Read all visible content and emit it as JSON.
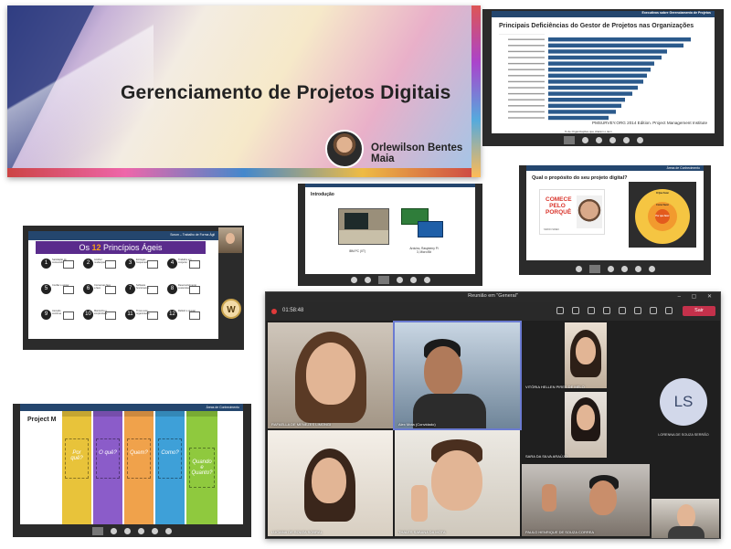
{
  "title_card": {
    "title": "Gerenciamento de Projetos Digitais",
    "presenter": "Orlewilson Bentes Maia"
  },
  "deficiencies_slide": {
    "header": "Executivos sobre Gerenciamento de Projetos",
    "title": "Principais Deficiências do Gestor de Projetos nas Organizações",
    "source": "PMSURVEY.ORG 2014 Edition. Project Management Institute",
    "xlabel": "% de Organizações que citaram o item"
  },
  "intro_slide": {
    "label": "Introdução",
    "header": "Contextualização",
    "pc_caption": "IBM PC (XT)",
    "board_caption": "Arduino, Raspberry Pi 3, Micro:Bit"
  },
  "purpose_slide": {
    "header": "Áreas de Conhecimento",
    "question": "Qual o propósito do seu projeto digital?",
    "book_title": "COMECE PELO PORQUÊ",
    "book_author": "SIMON SINEK",
    "gc_what": "O Que Fazer",
    "gc_how": "Como Fazer",
    "gc_why": "Por que fazer"
  },
  "agile_slide": {
    "header": "Scrum – Trabalho de Forma Ágil",
    "banner_prefix": "Os",
    "banner_number": "12",
    "banner_suffix": "Princípios Ágeis",
    "avatar_initial": "W",
    "principles": [
      {
        "n": "1",
        "t": "Satisfação do consumidor"
      },
      {
        "n": "2",
        "t": "Acolher mudanças"
      },
      {
        "n": "3",
        "t": "Entregas frequentes"
      },
      {
        "n": "4",
        "t": "Trabalho em conjunto"
      },
      {
        "n": "5",
        "t": "Confiar e apoiar"
      },
      {
        "n": "6",
        "t": "Conversas face a face"
      },
      {
        "n": "7",
        "t": "Software funcionando"
      },
      {
        "n": "8",
        "t": "Desenvolvimento sustentável"
      },
      {
        "n": "9",
        "t": "Atenção contínua"
      },
      {
        "n": "10",
        "t": "Mantenha a simplicidade"
      },
      {
        "n": "11",
        "t": "Times auto-organizáveis"
      },
      {
        "n": "12",
        "t": "Refletir e ajustar"
      }
    ]
  },
  "canvas_slide": {
    "header": "Áreas de Conhecimento",
    "label": "Project M",
    "columns": [
      {
        "color": "#e8c33a",
        "note": "Por quê?"
      },
      {
        "color": "#8b5cc9",
        "note": "O quê?"
      },
      {
        "color": "#f0a24b",
        "note": "Quem?"
      },
      {
        "color": "#3ea0d8",
        "note": "Como?"
      },
      {
        "color": "#8fc93e",
        "note": "Quando e Quanto?"
      }
    ]
  },
  "teams": {
    "window_title": "Reunião em \"General\"",
    "timer": "01:58:48",
    "leave_label": "Sair",
    "participants": [
      "RAFAELLA DE MENEZES LIMONGI",
      "Alex Mota (Convidado)",
      "VITÓRIA HELLEN PIRES DE MELO",
      "SARA DA SILVA ARAÚJO",
      "LUCIANA DE SOUZA SOBRAL",
      "THALES SABANA DA MOTA",
      "PAULO HENRIQUE DE SOUZA CORREA"
    ],
    "avatar_initials": "LS",
    "avatar_name": "LORENNA DE SOUZA SERRÃO"
  }
}
